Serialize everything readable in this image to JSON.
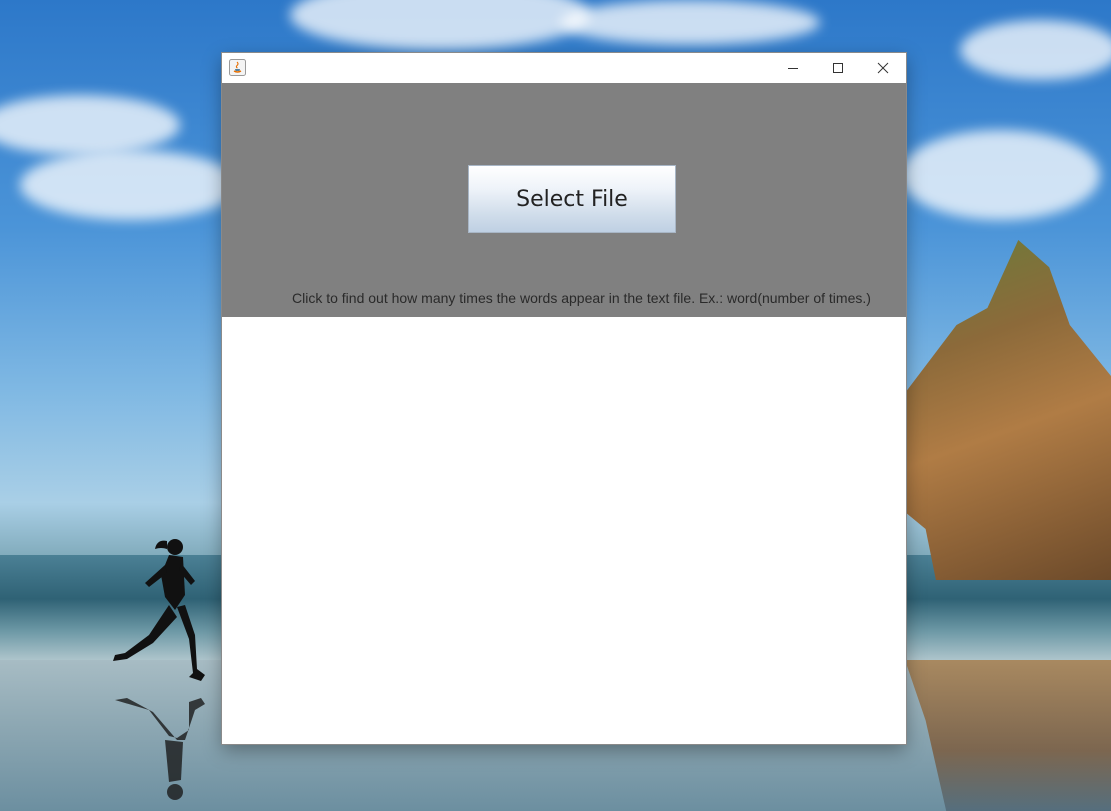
{
  "window": {
    "title": "",
    "controls": {
      "minimize_icon": "minimize-icon",
      "maximize_icon": "maximize-icon",
      "close_icon": "close-icon"
    },
    "app_icon": "java-icon"
  },
  "panel": {
    "select_button_label": "Select File",
    "hint_text": "Click to find out how many times the words appear in the text file. Ex.: word(number of times.)",
    "background_color": "#808080"
  },
  "output": {
    "value": ""
  }
}
